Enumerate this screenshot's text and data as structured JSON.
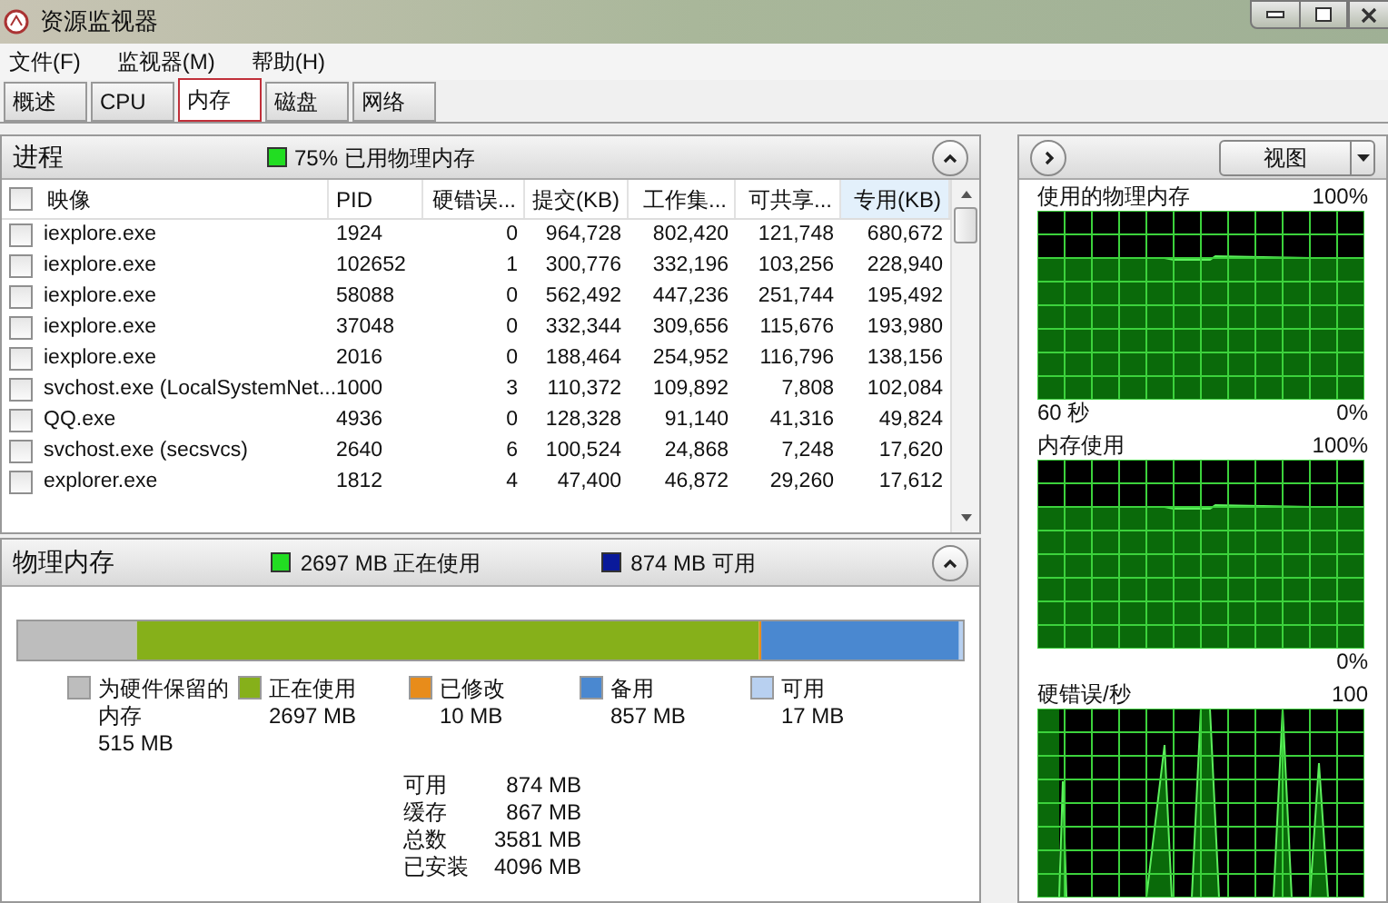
{
  "window": {
    "title": "资源监视器"
  },
  "menu": [
    "文件(F)",
    "监视器(M)",
    "帮助(H)"
  ],
  "tabs": [
    {
      "label": "概述",
      "selected": false
    },
    {
      "label": "CPU",
      "selected": false
    },
    {
      "label": "内存",
      "selected": true
    },
    {
      "label": "磁盘",
      "selected": false
    },
    {
      "label": "网络",
      "selected": false
    }
  ],
  "processes": {
    "title": "进程",
    "summary": {
      "text": "75% 已用物理内存",
      "color": "#22dd22"
    },
    "expanded": true,
    "columns": [
      {
        "label": "映像",
        "sorted": false
      },
      {
        "label": "PID",
        "sorted": false
      },
      {
        "label": "硬错误...",
        "sorted": false
      },
      {
        "label": "提交(KB)",
        "sorted": false
      },
      {
        "label": "工作集...",
        "sorted": false
      },
      {
        "label": "可共享...",
        "sorted": false
      },
      {
        "label": "专用(KB)",
        "sorted": true
      }
    ],
    "all_checked": false,
    "rows": [
      {
        "checked": false,
        "cells": [
          "iexplore.exe",
          "1924",
          "0",
          "964,728",
          "802,420",
          "121,748",
          "680,672"
        ]
      },
      {
        "checked": false,
        "cells": [
          "iexplore.exe",
          "102652",
          "1",
          "300,776",
          "332,196",
          "103,256",
          "228,940"
        ]
      },
      {
        "checked": false,
        "cells": [
          "iexplore.exe",
          "58088",
          "0",
          "562,492",
          "447,236",
          "251,744",
          "195,492"
        ]
      },
      {
        "checked": false,
        "cells": [
          "iexplore.exe",
          "37048",
          "0",
          "332,344",
          "309,656",
          "115,676",
          "193,980"
        ]
      },
      {
        "checked": false,
        "cells": [
          "iexplore.exe",
          "2016",
          "0",
          "188,464",
          "254,952",
          "116,796",
          "138,156"
        ]
      },
      {
        "checked": false,
        "cells": [
          "svchost.exe (LocalSystemNet...",
          "1000",
          "3",
          "110,372",
          "109,892",
          "7,808",
          "102,084"
        ]
      },
      {
        "checked": false,
        "cells": [
          "QQ.exe",
          "4936",
          "0",
          "128,328",
          "91,140",
          "41,316",
          "49,824"
        ]
      },
      {
        "checked": false,
        "cells": [
          "svchost.exe (secsvcs)",
          "2640",
          "6",
          "100,524",
          "24,868",
          "7,248",
          "17,620"
        ]
      },
      {
        "checked": false,
        "cells": [
          "explorer.exe",
          "1812",
          "4",
          "47,400",
          "46,872",
          "29,260",
          "17,612"
        ]
      }
    ]
  },
  "physical_memory": {
    "title": "物理内存",
    "expanded": true,
    "summary": [
      {
        "text": "2697 MB 正在使用",
        "color": "#22dd22"
      },
      {
        "text": "874 MB 可用",
        "color": "#0a1a9a"
      }
    ],
    "legend": [
      {
        "label": "为硬件保留的内存",
        "value": "515 MB",
        "color": "#bdbdbd"
      },
      {
        "label": "正在使用",
        "value": "2697 MB",
        "color": "#86b01a"
      },
      {
        "label": "已修改",
        "value": "10 MB",
        "color": "#e88c1a"
      },
      {
        "label": "备用",
        "value": "857 MB",
        "color": "#4a88d0"
      },
      {
        "label": "可用",
        "value": "17 MB",
        "color": "#b8d0f0"
      }
    ],
    "stats": [
      {
        "label": "可用",
        "value": "874 MB"
      },
      {
        "label": "缓存",
        "value": "867 MB"
      },
      {
        "label": "总数",
        "value": "3581 MB"
      },
      {
        "label": "已安装",
        "value": "4096 MB"
      }
    ]
  },
  "right_pane": {
    "view_button": "视图",
    "graphs": [
      {
        "kind": "area",
        "title": "使用的物理内存",
        "max": "100%",
        "time": "60 秒",
        "min": "0%"
      },
      {
        "kind": "area",
        "title": "内存使用",
        "max": "100%",
        "min": "0%"
      },
      {
        "kind": "spikes",
        "title": "硬错误/秒",
        "max": "100"
      }
    ]
  }
}
